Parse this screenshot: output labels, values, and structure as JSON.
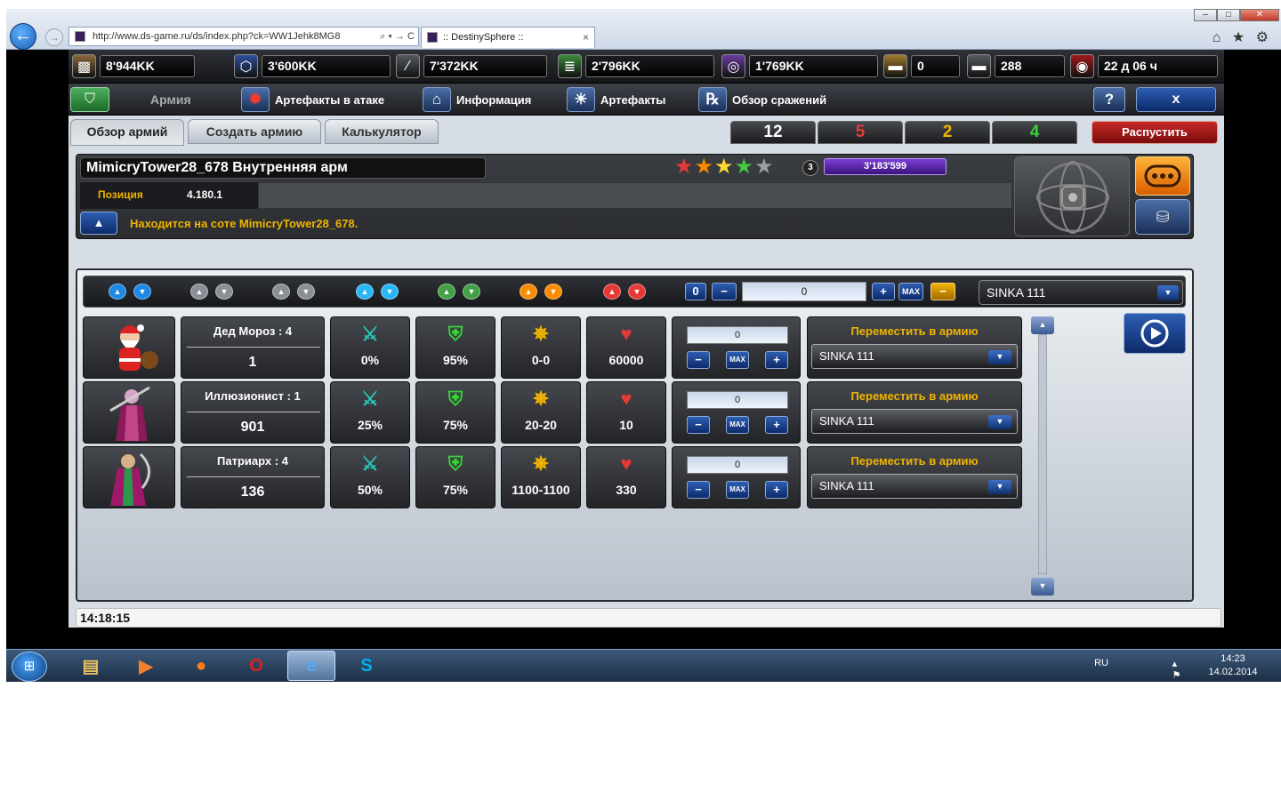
{
  "browser": {
    "address": "http://www.ds-game.ru/ds/index.php?ck=WW1Jehk8MG8",
    "address_controls": "⌕ ▾ → C",
    "tab_title": ":: DestinySphere ::",
    "tab_close": "×",
    "back_icon": "←",
    "forward_icon": "→",
    "window_buttons": [
      "–",
      "□",
      "✕"
    ],
    "toolbar_icons": "⌂ ★ ⚙"
  },
  "resources": [
    {
      "icon": "▩",
      "value": "8'944KK",
      "color": "#8a6a3c"
    },
    {
      "icon": "⬡",
      "value": "3'600KK",
      "color": "#2d4fa0"
    },
    {
      "icon": "∕",
      "value": "7'372KK",
      "color": "#555a60"
    },
    {
      "icon": "≣",
      "value": "2'796KK",
      "color": "#3c8a3c"
    },
    {
      "icon": "◎",
      "value": "1'769KK",
      "color": "#6a3ca0"
    },
    {
      "icon": "▬",
      "value": "0",
      "color": "#a07a2d"
    },
    {
      "icon": "▬",
      "value": "288",
      "color": "#555a60"
    },
    {
      "icon": "◉",
      "value": "22 д 06 ч",
      "color": "#a01c1c"
    }
  ],
  "menu": {
    "army_label": "Армия",
    "items": [
      {
        "label": "Артефакты в атаке",
        "icon": "✹"
      },
      {
        "label": "Информация",
        "icon": "⌂"
      },
      {
        "label": "Артефакты",
        "icon": "☀"
      },
      {
        "label": "Обзор сражений",
        "icon": "℞"
      }
    ],
    "help_label": "?",
    "close_label": "x"
  },
  "tabs": [
    {
      "label": "Обзор армий",
      "active": true
    },
    {
      "label": "Создать армию",
      "active": false
    },
    {
      "label": "Калькулятор",
      "active": false
    }
  ],
  "counters": [
    {
      "value": "12",
      "color": "#ffffff"
    },
    {
      "value": "5",
      "color": "#e53935"
    },
    {
      "value": "2",
      "color": "#f0b400"
    },
    {
      "value": "4",
      "color": "#3ad13a"
    }
  ],
  "disband_label": "Распустить",
  "army": {
    "name": "MimicryTower28_678 Внутренняя арм",
    "position_label": "Позиция",
    "position_value": "4.180.1",
    "location_text": "Находится на соте MimicryTower28_678.",
    "stars": [
      {
        "glyph": "★",
        "color": "#e53935"
      },
      {
        "glyph": "★",
        "color": "#fb8c00"
      },
      {
        "glyph": "★",
        "color": "#fdd835"
      },
      {
        "glyph": "★",
        "color": "#43c843"
      },
      {
        "glyph": "★",
        "color": "#9aa0a6"
      }
    ],
    "star_count": "3",
    "xp": "3'183'599"
  },
  "sort_colors": [
    "#1e88e5",
    "#8a8f96",
    "#8a8f96",
    "#29b6f6",
    "#43a047",
    "#fb8c00",
    "#e53935"
  ],
  "sort_icons": {
    "up": "▲",
    "down": "▼"
  },
  "toolbar": {
    "qty_value": "0",
    "minus_label": "−",
    "plus_label": "+",
    "max_label": "MAX",
    "zero_label": "0",
    "selected_army": "SINKA 111",
    "dropdown_icon": "▼"
  },
  "units": [
    {
      "name": "Дед Мороз : 4",
      "count": "1",
      "attack_pct": "0%",
      "defense_pct": "95%",
      "damage": "0-0",
      "hp": "60000",
      "qty": "0",
      "move_label": "Переместить в армию",
      "target": "SINKA 111"
    },
    {
      "name": "Иллюзионист : 1",
      "count": "901",
      "attack_pct": "25%",
      "defense_pct": "75%",
      "damage": "20-20",
      "hp": "10",
      "qty": "0",
      "move_label": "Переместить в армию",
      "target": "SINKA 111"
    },
    {
      "name": "Патриарх : 4",
      "count": "136",
      "attack_pct": "50%",
      "defense_pct": "75%",
      "damage": "1100-1100",
      "hp": "330",
      "qty": "0",
      "move_label": "Переместить в армию",
      "target": "SINKA 111"
    }
  ],
  "stat_icons": {
    "attack": "⚔",
    "defense": "⛨",
    "damage": "✵",
    "hp": "♥"
  },
  "stat_colors": {
    "attack": "#28c3b4",
    "defense": "#3ad13a",
    "damage": "#f0b400",
    "hp": "#e53935"
  },
  "server_time": "14:18:15",
  "taskbar": {
    "apps": [
      {
        "icon": "▤",
        "color": "#e8c060"
      },
      {
        "icon": "▶",
        "color": "#f08030"
      },
      {
        "icon": "●",
        "color": "#ff7a1a"
      },
      {
        "icon": "O",
        "color": "#e02020"
      },
      {
        "icon": "e",
        "color": "#4fa8ff"
      },
      {
        "icon": "S",
        "color": "#00aff0"
      }
    ],
    "lang": "RU",
    "tray_icons": "▴ ⚑ ▣ ♪",
    "time": "14:23",
    "date": "14.02.2014"
  }
}
